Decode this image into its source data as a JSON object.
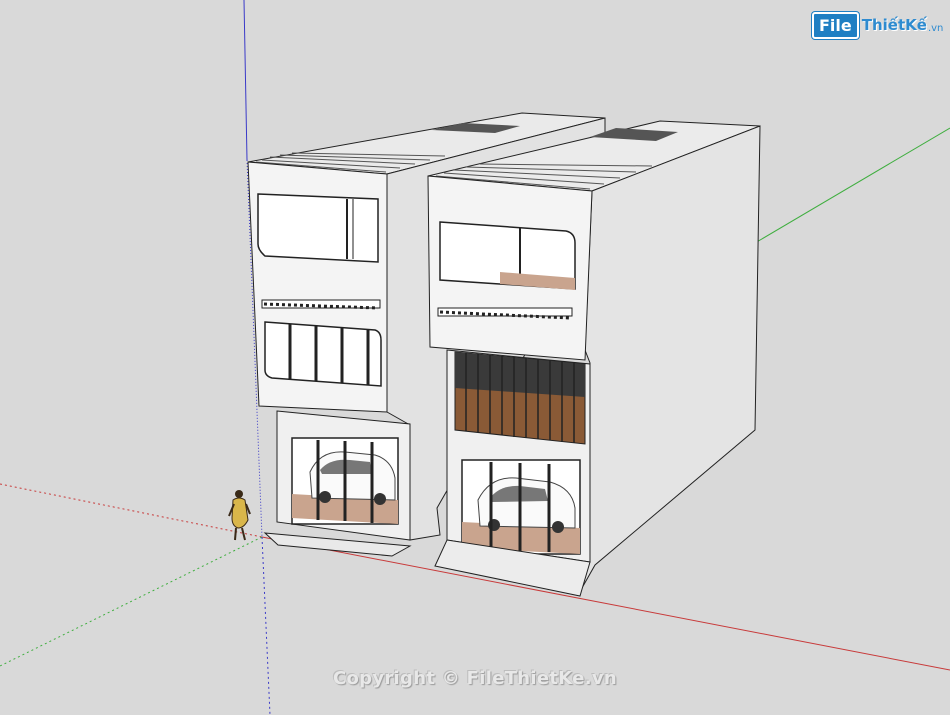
{
  "watermark": {
    "logo_file": "File",
    "logo_name": "ThiếtKế",
    "logo_tld": ".vn",
    "copyright": "Copyright © FileThietKe.vn"
  },
  "colors": {
    "background": "#d9d9d9",
    "axis_red": "#c83a3a",
    "axis_green": "#3fae3f",
    "axis_blue": "#3a3ac8",
    "wall": "#f2f2f2",
    "wall_shade": "#dcdcdc",
    "wood": "#8a5a36"
  },
  "scene": {
    "buildings": [
      "townhouse-left",
      "townhouse-right"
    ],
    "figure": "person-figure"
  }
}
